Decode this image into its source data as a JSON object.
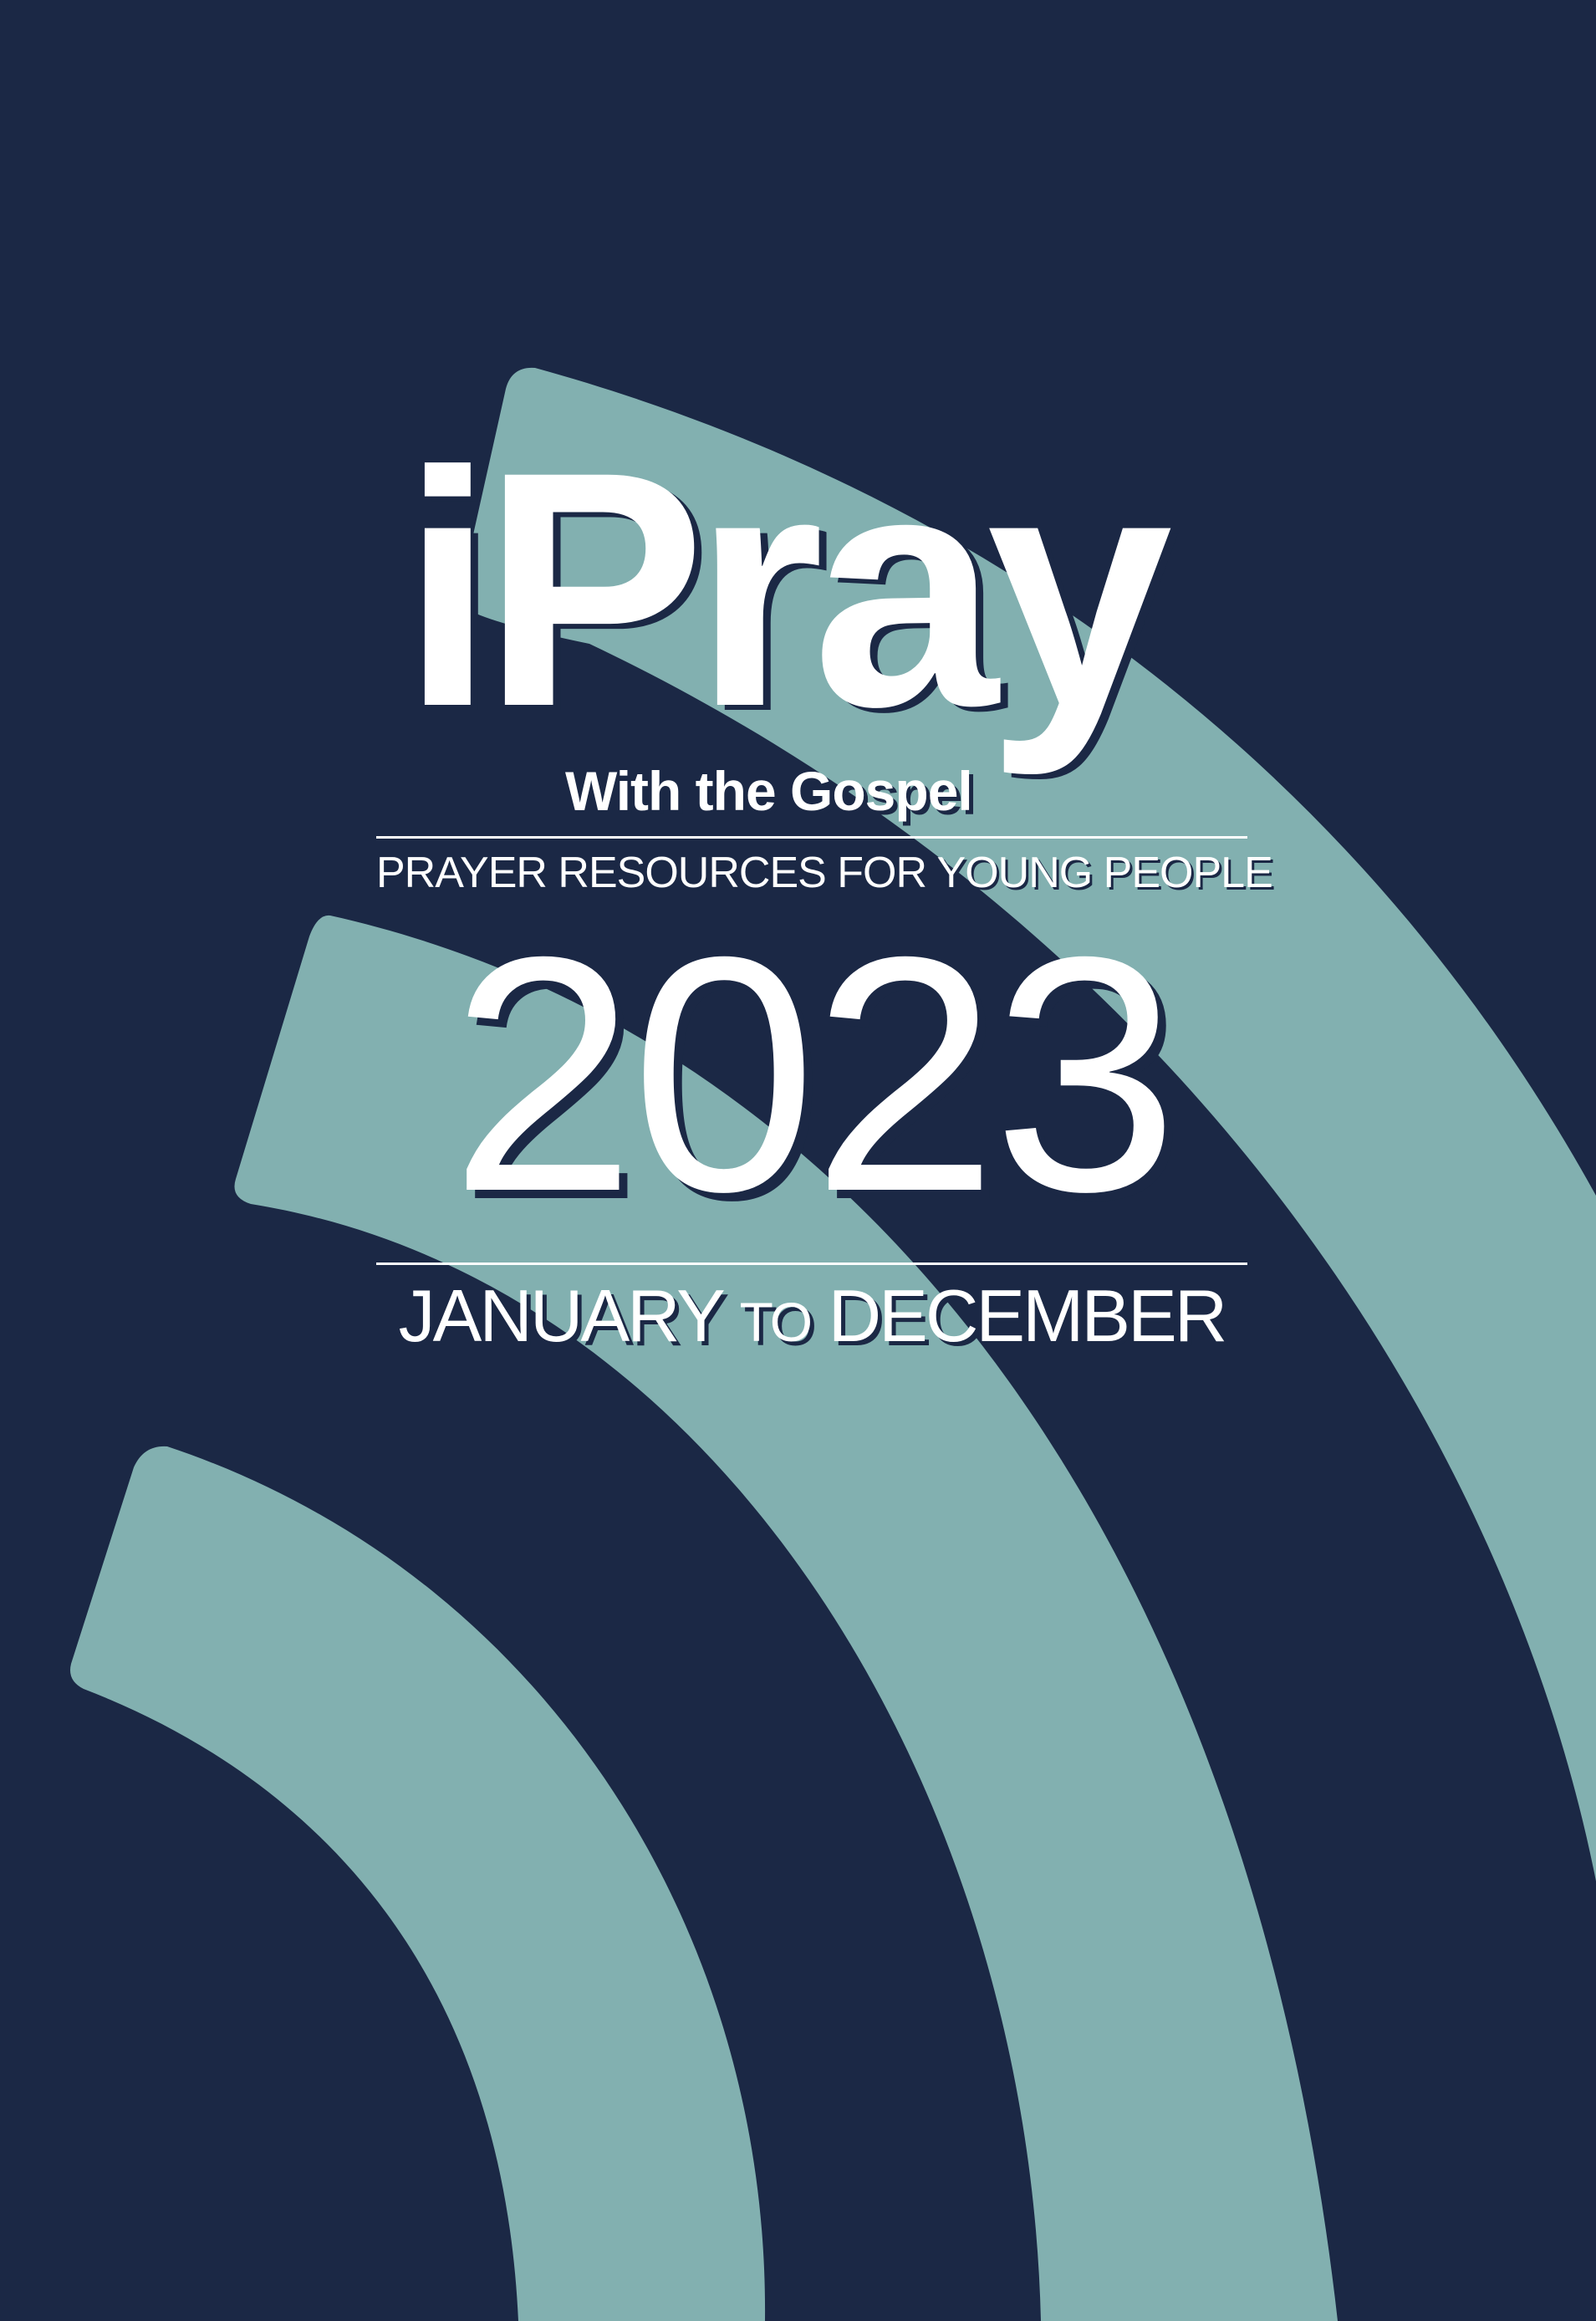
{
  "cover": {
    "logo_text": "iPray",
    "tagline": "With the Gospel",
    "subtitle": "PRAYER RESOURCES FOR YOUNG PEOPLE",
    "year": "2023",
    "range": {
      "start": "JANUARY",
      "connector": "TO",
      "end": "DECEMBER"
    }
  },
  "colors": {
    "background": "#1b2845",
    "arc": "#82b0b0",
    "text": "#ffffff"
  }
}
